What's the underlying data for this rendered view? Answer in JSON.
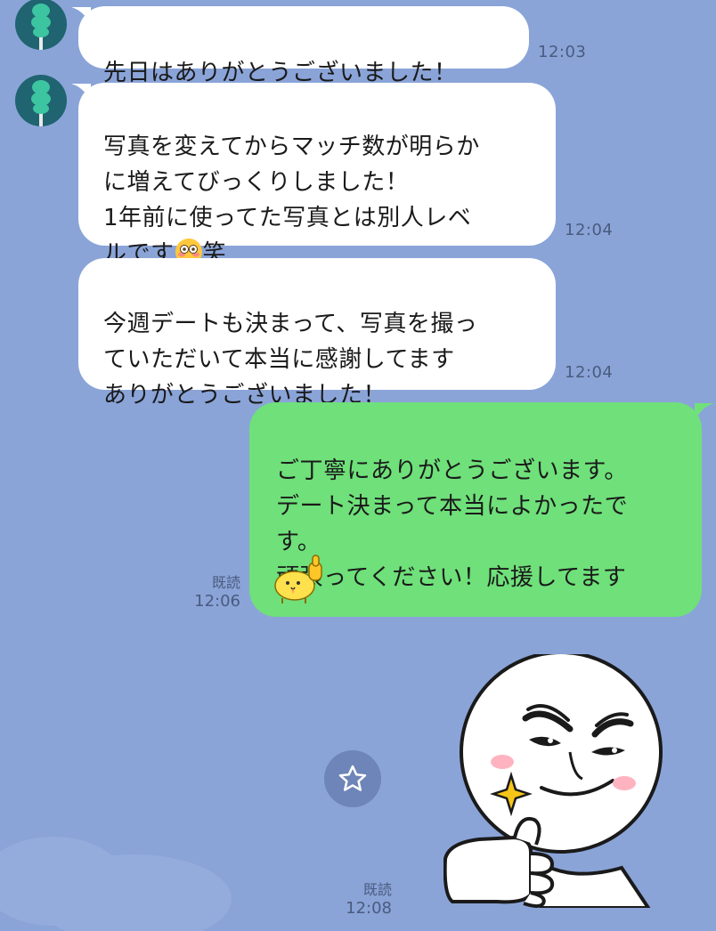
{
  "messages": {
    "m1": {
      "text": "先日はありがとうございました！",
      "time": "12:03"
    },
    "m2": {
      "line1": "写真を変えてからマッチ数が明らか\nに増えてびっくりしました！\n1年前に使ってた写真とは別人レベ\nルです",
      "suffix": "笑",
      "emoji": "flushed-face-emoji",
      "time": "12:04"
    },
    "m3": {
      "text": "今週デートも決まって、写真を撮っ\nていただいて本当に感謝してます\nありがとうございました！",
      "time": "12:04"
    },
    "m4": {
      "text": "ご丁寧にありがとうございます。\nデート決まって本当によかったで\nす。\n頑張ってください！応援してます",
      "read": "既読",
      "time": "12:06",
      "sticker": "thumbs-up-chick-sticker"
    },
    "m5": {
      "sticker": "brown-thumbs-up-sticker",
      "read": "既読",
      "time": "12:08"
    }
  },
  "icons": {
    "avatar": "green-figure-avatar",
    "star": "star-icon"
  },
  "colors": {
    "background": "#8aa4d8",
    "incoming_bubble": "#ffffff",
    "outgoing_bubble": "#6fe07a",
    "timestamp": "#4a5b7e"
  }
}
